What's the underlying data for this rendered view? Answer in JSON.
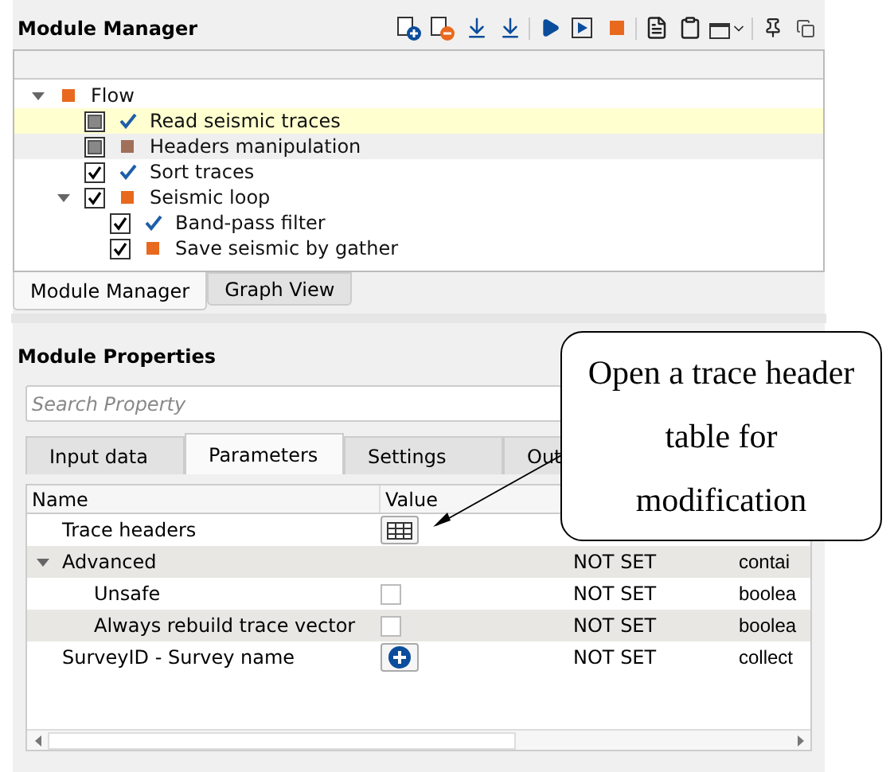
{
  "module_manager": {
    "title": "Module Manager",
    "tree": [
      {
        "label": "Flow",
        "kind": "square",
        "color": "#e8691e",
        "selected": false,
        "hovered": false,
        "expanded": true,
        "children": [
          {
            "label": "Read seismic traces",
            "checked": false,
            "indeterminate": true,
            "kind": "check",
            "selected": true,
            "hovered": false
          },
          {
            "label": "Headers manipulation",
            "checked": false,
            "indeterminate": true,
            "kind": "square",
            "color": "#a0705a",
            "selected": false,
            "hovered": true
          },
          {
            "label": "Sort traces",
            "checked": true,
            "indeterminate": false,
            "kind": "check",
            "selected": false,
            "hovered": false
          },
          {
            "label": "Seismic loop",
            "checked": true,
            "indeterminate": false,
            "kind": "square",
            "color": "#e8691e",
            "selected": false,
            "hovered": false,
            "expanded": true,
            "children": [
              {
                "label": "Band-pass filter",
                "checked": true,
                "indeterminate": false,
                "kind": "check",
                "selected": false,
                "hovered": false
              },
              {
                "label": "Save seismic by gather",
                "checked": true,
                "indeterminate": false,
                "kind": "square",
                "color": "#e8691e",
                "selected": false,
                "hovered": false
              }
            ]
          }
        ]
      }
    ],
    "bottom_tabs": [
      {
        "label": "Module Manager",
        "selected": true
      },
      {
        "label": "Graph View",
        "selected": false
      }
    ]
  },
  "module_properties": {
    "title": "Module Properties",
    "search": {
      "placeholder": "Search Property"
    },
    "tabs": [
      {
        "label": "Input data",
        "selected": false
      },
      {
        "label": "Parameters",
        "selected": true
      },
      {
        "label": "Settings",
        "selected": false
      },
      {
        "label": "Out",
        "selected": false
      }
    ],
    "table": {
      "columns": [
        "Name",
        "Value"
      ],
      "rows": [
        {
          "name": "Trace headers",
          "kind": "table_button"
        },
        {
          "name": "Advanced",
          "expanded": true,
          "status": "NOT SET",
          "type": "contai",
          "children": [
            {
              "name": "Unsafe",
              "kind": "checkbox",
              "checked": false,
              "status": "NOT SET",
              "type": "boolea"
            },
            {
              "name": "Always rebuild trace vector",
              "kind": "checkbox",
              "checked": false,
              "status": "NOT SET",
              "type": "boolea"
            }
          ]
        },
        {
          "name": "SurveyID - Survey name",
          "kind": "add_button",
          "status": "NOT SET",
          "type": "collect"
        }
      ]
    }
  },
  "callout": {
    "text": "Open a trace header table for modification"
  }
}
